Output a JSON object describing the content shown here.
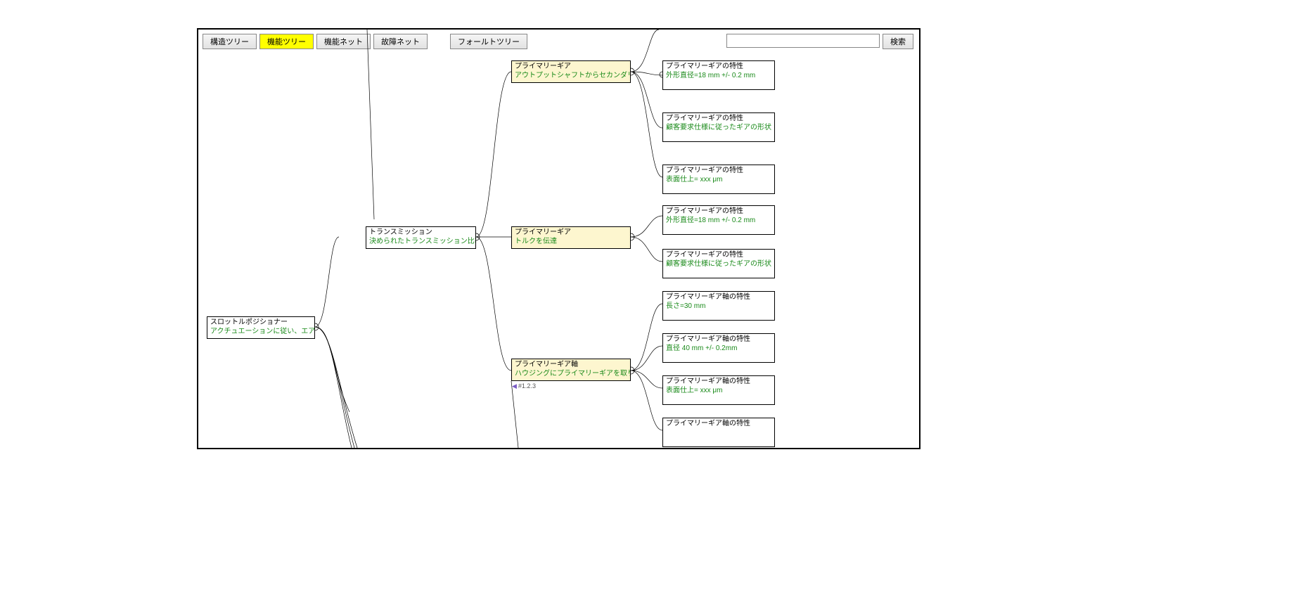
{
  "toolbar": {
    "structure_tree": "構造ツリー",
    "function_tree": "機能ツリー",
    "function_net": "機能ネット",
    "failure_net": "故障ネット",
    "fault_tree": "フォールトツリー",
    "search_label": "検索",
    "search_value": ""
  },
  "nodes": {
    "root": {
      "title": "スロットルポジショナー",
      "sub": "アクチュエーションに従い、エアーの開口調整"
    },
    "transmission": {
      "title": "トランスミッション",
      "sub": "決められたトランスミッション比率でのエンジンと..."
    },
    "primary_gear_1": {
      "title": "プライマリーギア",
      "sub": "アウトプットシャフトからセカンダリーギアに対してト..."
    },
    "primary_gear_2": {
      "title": "プライマリーギア",
      "sub": "トルクを伝達"
    },
    "primary_gear_shaft": {
      "title": "プライマリーギア軸",
      "sub": "ハウジングにプライマリーギアを取り付け",
      "tag": "#1.2.3"
    },
    "prop_g1_a": {
      "title": "プライマリーギアの特性",
      "sub": "外形直径=18 mm +/- 0.2 mm"
    },
    "prop_g1_b": {
      "title": "プライマリーギアの特性",
      "sub": "顧客要求仕様に従ったギアの形状"
    },
    "prop_g1_c": {
      "title": "プライマリーギアの特性",
      "sub": "表面仕上= xxx μm"
    },
    "prop_g2_a": {
      "title": "プライマリーギアの特性",
      "sub": "外形直径=18 mm +/- 0.2 mm"
    },
    "prop_g2_b": {
      "title": "プライマリーギアの特性",
      "sub": "顧客要求仕様に従ったギアの形状"
    },
    "prop_s_a": {
      "title": "プライマリーギア軸の特性",
      "sub": "長さ=30 mm"
    },
    "prop_s_b": {
      "title": "プライマリーギア軸の特性",
      "sub": "直径 40 mm +/- 0.2mm"
    },
    "prop_s_c": {
      "title": "プライマリーギア軸の特性",
      "sub": "表面仕上= xxx μm"
    },
    "prop_s_d": {
      "title": "プライマリーギア軸の特性",
      "sub": ""
    }
  }
}
